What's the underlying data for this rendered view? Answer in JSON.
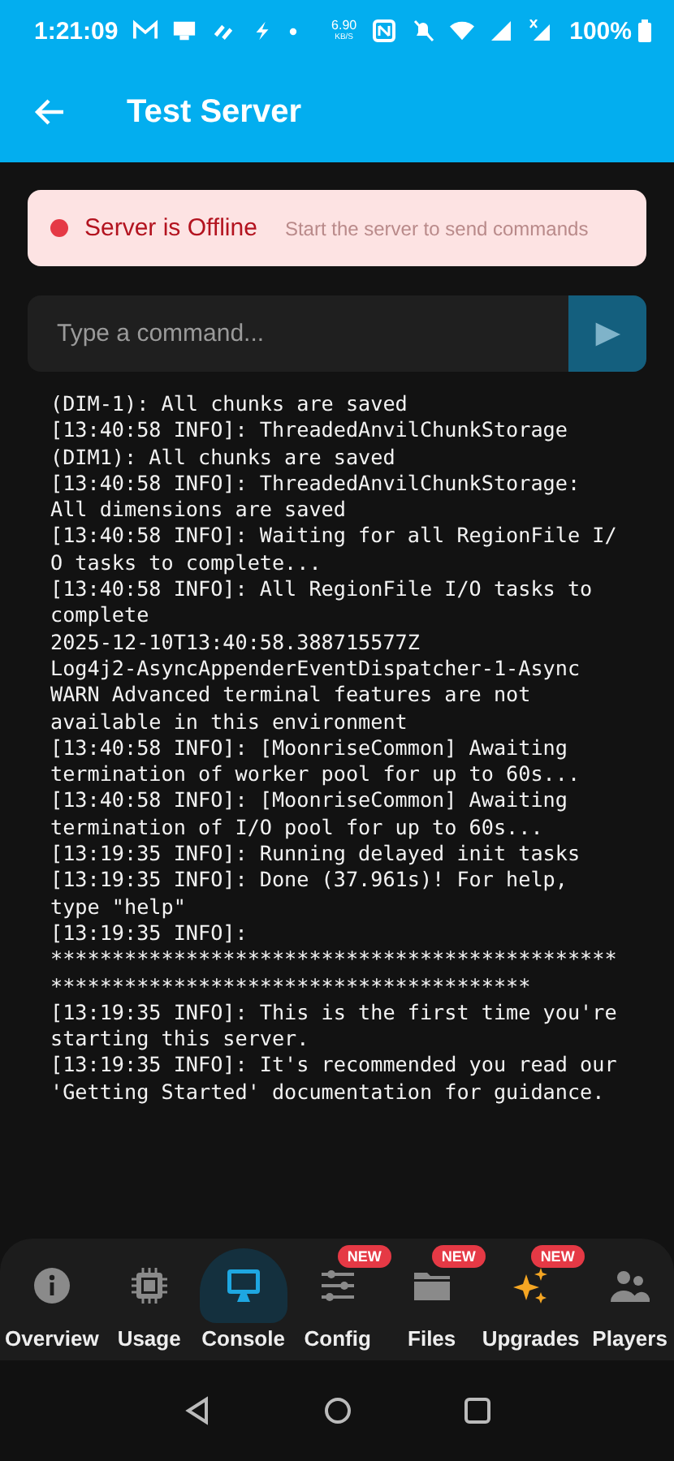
{
  "status_bar": {
    "time": "1:21:09",
    "net_speed": "6.90",
    "net_unit": "KB/S",
    "battery": "100%"
  },
  "app_bar": {
    "title": "Test Server"
  },
  "server_status": {
    "label": "Server is Offline",
    "hint": "Start the server to send commands",
    "online": false
  },
  "command_input": {
    "placeholder": "Type a command...",
    "disabled": true
  },
  "console_lines": [
    "(DIM-1): All chunks are saved",
    "[13:40:58 INFO]: ThreadedAnvilChunkStorage",
    "(DIM1): All chunks are saved",
    "[13:40:58 INFO]: ThreadedAnvilChunkStorage:",
    "All dimensions are saved",
    "[13:40:58 INFO]: Waiting for all RegionFile I/",
    "O tasks to complete...",
    "[13:40:58 INFO]: All RegionFile I/O tasks to",
    "complete",
    "2025-12-10T13:40:58.388715577Z",
    "Log4j2-AsyncAppenderEventDispatcher-1-Async",
    "WARN Advanced terminal features are not",
    "available in this environment",
    "[13:40:58 INFO]: [MoonriseCommon] Awaiting",
    "termination of worker pool for up to 60s...",
    "[13:40:58 INFO]: [MoonriseCommon] Awaiting",
    "termination of I/O pool for up to 60s...",
    "[13:19:35 INFO]: Running delayed init tasks",
    "[13:19:35 INFO]: Done (37.961s)! For help,",
    "type \"help\"",
    "[13:19:35 INFO]:",
    "**********************************************",
    "***************************************",
    "[13:19:35 INFO]: This is the first time you're",
    "starting this server.",
    "[13:19:35 INFO]: It's recommended you read our",
    "'Getting Started' documentation for guidance."
  ],
  "tabs": [
    {
      "label": "Overview",
      "kind": "info",
      "selected": false
    },
    {
      "label": "Usage",
      "kind": "chip",
      "selected": false
    },
    {
      "label": "Console",
      "kind": "monitor",
      "selected": true
    },
    {
      "label": "Config",
      "kind": "sliders",
      "selected": false,
      "badge": "NEW"
    },
    {
      "label": "Files",
      "kind": "folder",
      "selected": false,
      "badge": "NEW"
    },
    {
      "label": "Upgrades",
      "kind": "sparkle",
      "selected": false,
      "badge": "NEW"
    },
    {
      "label": "Players",
      "kind": "people",
      "selected": false
    }
  ]
}
